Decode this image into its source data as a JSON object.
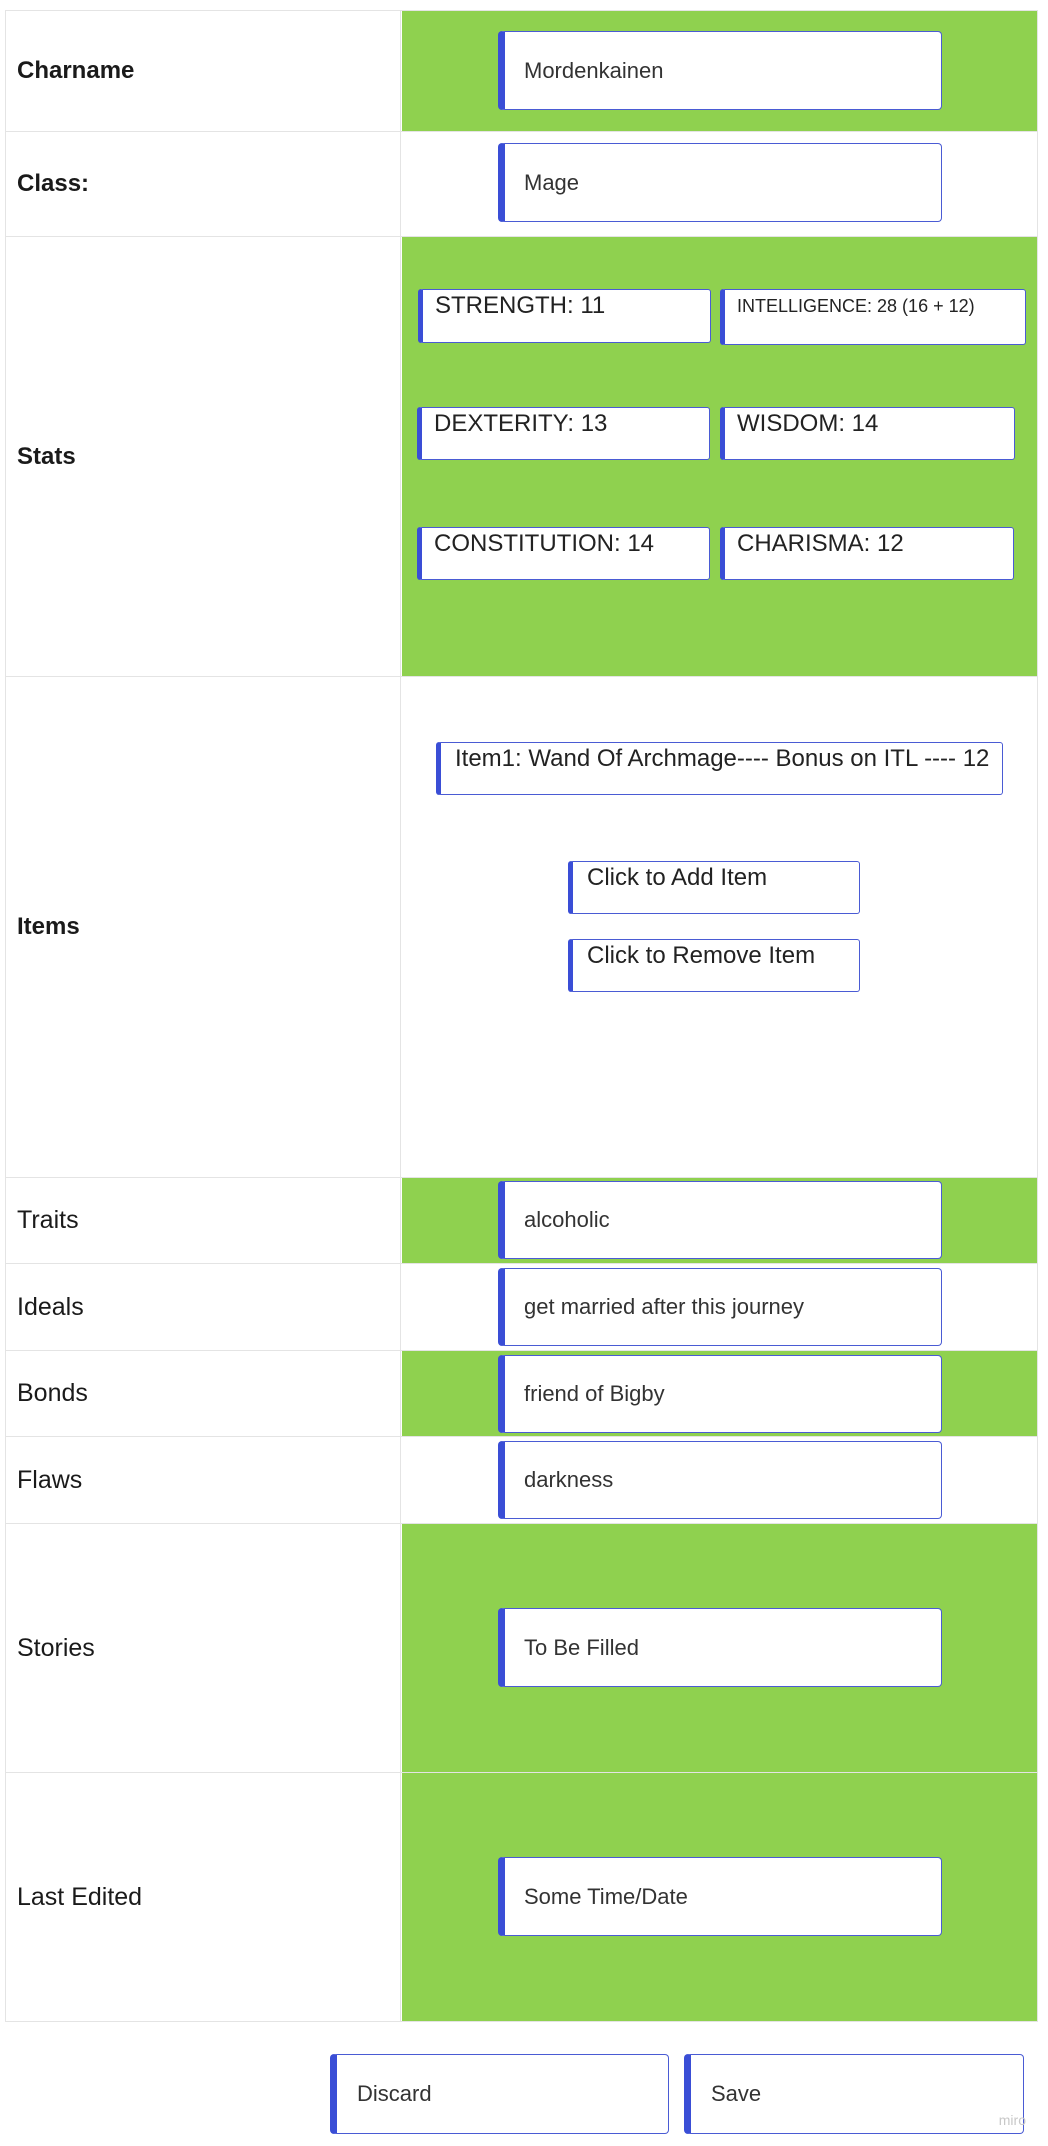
{
  "form": {
    "charname": {
      "label": "Charname",
      "value": "Mordenkainen"
    },
    "class": {
      "label": "Class:",
      "value": "Mage"
    },
    "stats": {
      "label": "Stats",
      "strength": "STRENGTH: 11",
      "intelligence": "INTELLIGENCE: 28 (16 + 12)",
      "dexterity": "DEXTERITY: 13",
      "wisdom": "WISDOM: 14",
      "constitution": "CONSTITUTION: 14",
      "charisma": "CHARISMA: 12"
    },
    "items": {
      "label": "Items",
      "list": [
        "Item1: Wand Of Archmage---- Bonus on ITL ---- 12"
      ],
      "add_label": "Click to Add Item",
      "remove_label": "Click to Remove Item"
    },
    "traits": {
      "label": "Traits",
      "value": "alcoholic"
    },
    "ideals": {
      "label": "Ideals",
      "value": "get married after this journey"
    },
    "bonds": {
      "label": "Bonds",
      "value": "friend of Bigby"
    },
    "flaws": {
      "label": "Flaws",
      "value": "darkness"
    },
    "stories": {
      "label": "Stories",
      "value": "To Be Filled"
    },
    "last_edited": {
      "label": "Last Edited",
      "value": "Some Time/Date"
    }
  },
  "actions": {
    "discard_label": "Discard",
    "save_label": "Save"
  },
  "watermark": "miro",
  "colors": {
    "accent_green": "#8fd14f",
    "field_border": "#3a4ed6"
  }
}
